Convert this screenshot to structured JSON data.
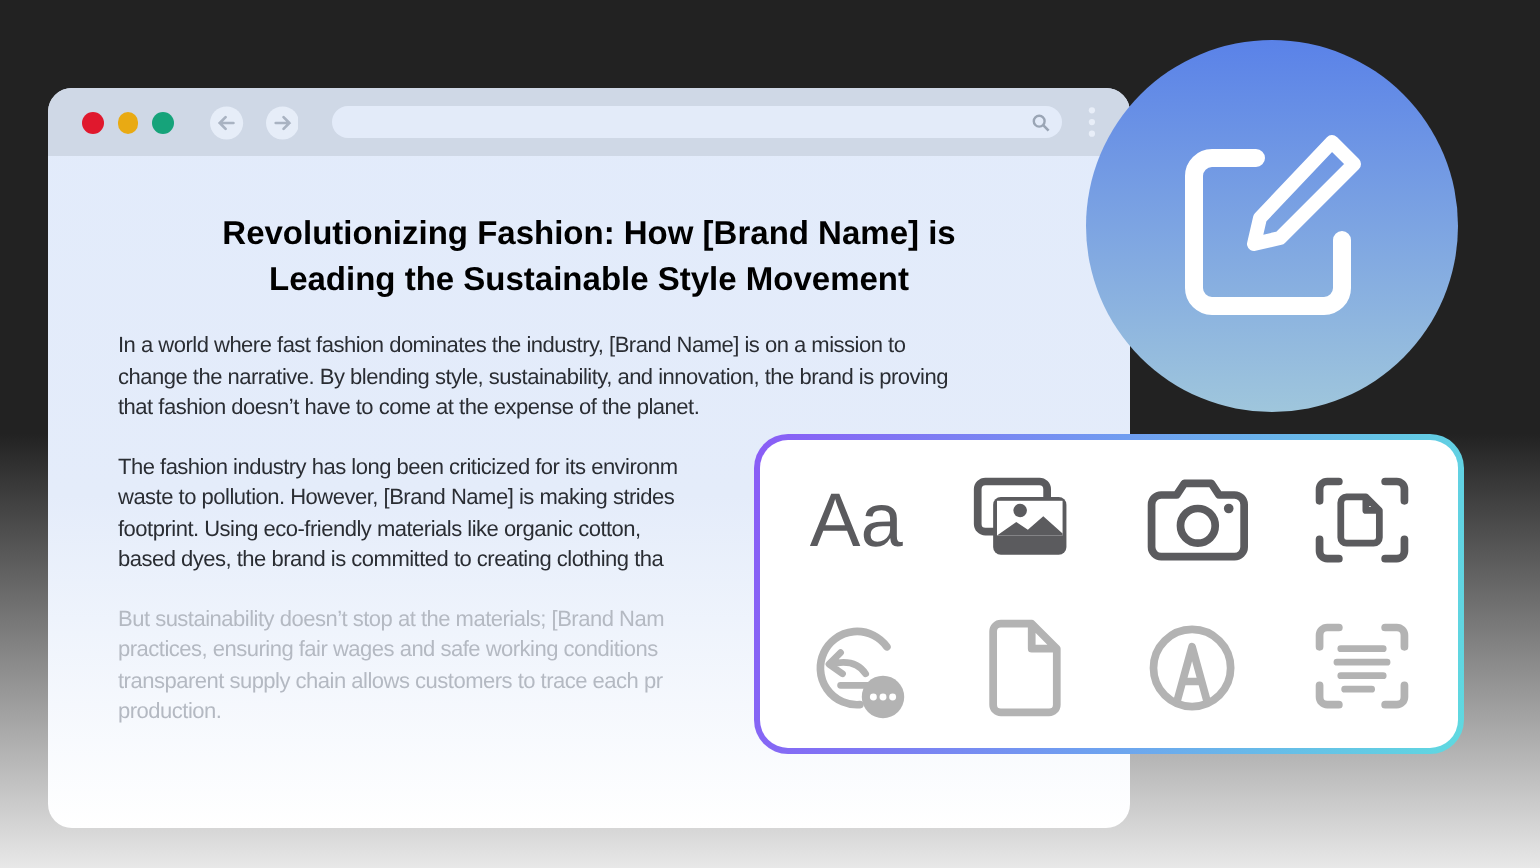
{
  "article": {
    "heading": "Revolutionizing Fashion: How [Brand Name] is Leading the Sustainable Style Movement",
    "paragraphs": [
      {
        "muted": false,
        "lines": [
          "In a world where fast fashion dominates the industry, [Brand Name] is on a mission to",
          "change the narrative. By blending style, sustainability, and innovation, the brand is proving",
          "that fashion doesn’t have to come at the expense of the planet."
        ]
      },
      {
        "muted": false,
        "lines": [
          "The fashion industry has long been criticized for its environm",
          "waste to pollution. However, [Brand Name] is making strides",
          "footprint. Using eco-friendly materials like organic cotton,",
          "based dyes, the brand is committed to creating clothing tha"
        ]
      },
      {
        "muted": true,
        "lines": [
          "But sustainability doesn’t stop at the materials; [Brand Nam",
          "practices, ensuring fair wages and safe working conditions",
          "transparent supply chain allows customers to trace each pr",
          "production."
        ]
      }
    ]
  },
  "tools": [
    {
      "kind": "text",
      "label": "Aa",
      "disabled": false
    },
    {
      "kind": "gallery",
      "disabled": false
    },
    {
      "kind": "camera",
      "disabled": false
    },
    {
      "kind": "scan-document",
      "disabled": false
    },
    {
      "kind": "reply-more",
      "disabled": true
    },
    {
      "kind": "document",
      "disabled": true
    },
    {
      "kind": "pen-circle",
      "disabled": true
    },
    {
      "kind": "scan-text",
      "disabled": true
    }
  ]
}
